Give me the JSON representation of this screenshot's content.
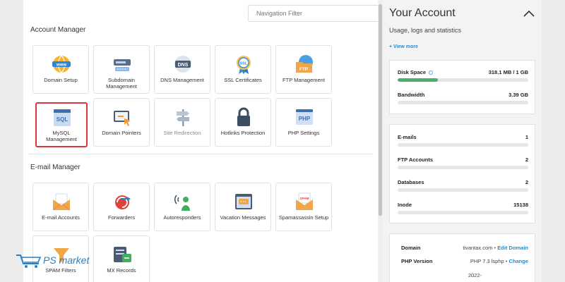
{
  "filter": {
    "placeholder": "Navigation Filter"
  },
  "account_manager": {
    "title": "Account Manager",
    "tiles": [
      {
        "label": "Domain Setup",
        "icon": "www-globe-icon"
      },
      {
        "label": "Subdomain Management",
        "icon": "subdomain-icon"
      },
      {
        "label": "DNS Management",
        "icon": "dns-icon"
      },
      {
        "label": "SSL Certificates",
        "icon": "ssl-badge-icon"
      },
      {
        "label": "FTP Management",
        "icon": "ftp-folder-icon"
      },
      {
        "label": "MySQL Management",
        "icon": "sql-database-icon"
      },
      {
        "label": "Domain Pointers",
        "icon": "domain-pointer-icon"
      },
      {
        "label": "Site Redirection",
        "icon": "signpost-icon"
      },
      {
        "label": "Hotlinks Protection",
        "icon": "padlock-icon"
      },
      {
        "label": "PHP Settings",
        "icon": "php-icon"
      }
    ]
  },
  "email_manager": {
    "title": "E-mail Manager",
    "tiles": [
      {
        "label": "E-mail Accounts",
        "icon": "envelope-icon"
      },
      {
        "label": "Forwarders",
        "icon": "forward-icon"
      },
      {
        "label": "Autoresponders",
        "icon": "autoresponder-icon"
      },
      {
        "label": "Vacation Messages",
        "icon": "vacation-message-icon"
      },
      {
        "label": "Spamassassin Setup",
        "icon": "spam-envelope-icon"
      },
      {
        "label": "SPAM Filters",
        "icon": "spam-filter-icon"
      },
      {
        "label": "MX Records",
        "icon": "mx-records-icon"
      }
    ]
  },
  "side": {
    "title": "Your Account",
    "subtitle": "Usage, logs and statistics",
    "view_more": "+ View more",
    "disk": {
      "label": "Disk Space",
      "value": "318.1 MB / 1 GB",
      "fraction": 0.31
    },
    "bandwidth": {
      "label": "Bandwidth",
      "value": "3.39 GB",
      "fraction": 0
    },
    "counts": [
      {
        "label": "E-mails",
        "value": "1"
      },
      {
        "label": "FTP Accounts",
        "value": "2"
      },
      {
        "label": "Databases",
        "value": "2"
      },
      {
        "label": "Inode",
        "value": "15138"
      }
    ],
    "domain": {
      "label": "Domain",
      "value": "tivantax.com",
      "action": "Edit Domain"
    },
    "php": {
      "label": "PHP Version",
      "value": "PHP 7.3 lsphp",
      "action": "Change"
    },
    "date_partial": "2022-"
  },
  "watermark": {
    "text": "PS market"
  },
  "colors": {
    "accent": "#2a8cc9",
    "bar_fill": "#4caf6e",
    "selected_border": "#d9373c"
  }
}
